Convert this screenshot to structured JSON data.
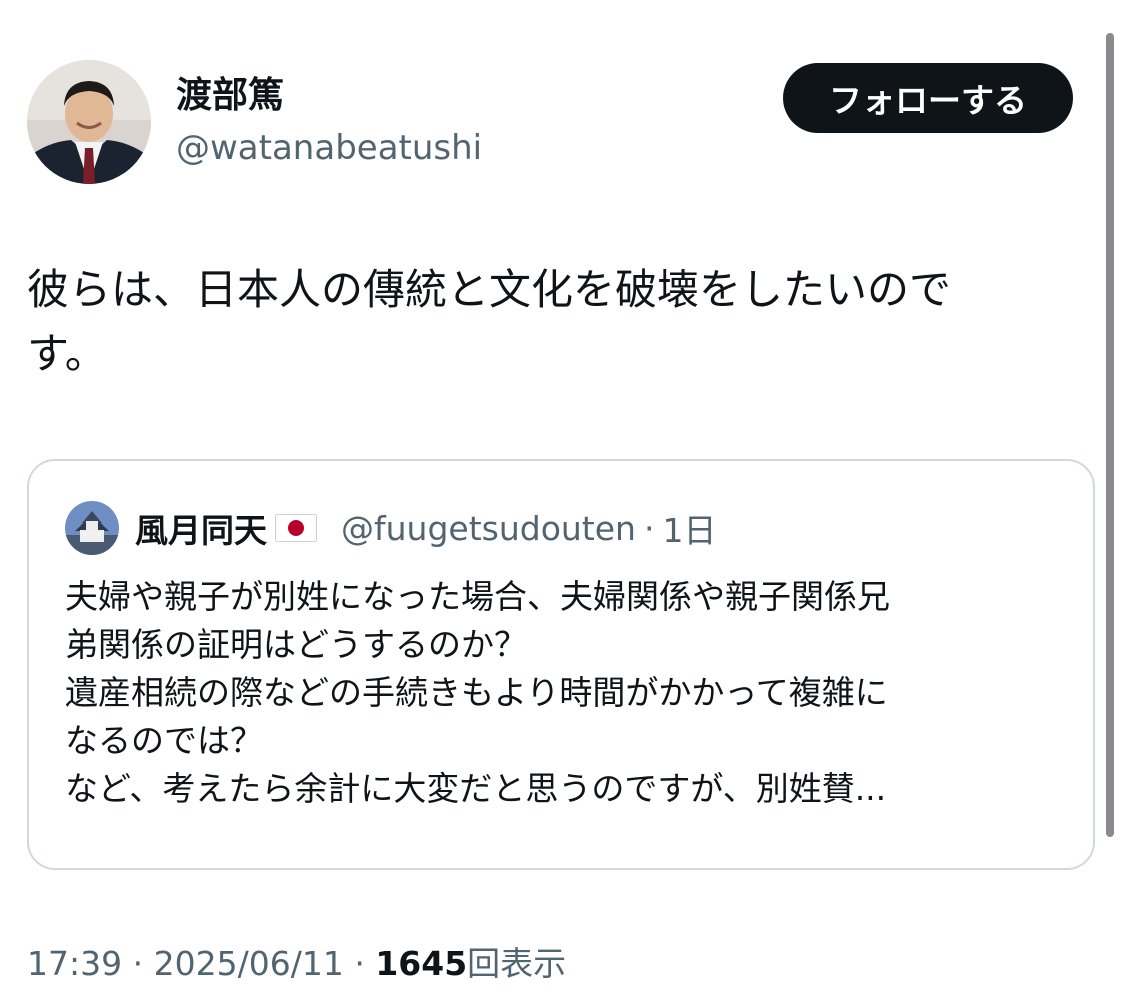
{
  "author": {
    "name": "渡部篤",
    "handle": "@watanabeatushi"
  },
  "follow_button": {
    "label": "フォローする"
  },
  "tweet": {
    "lines": [
      "彼らは、日本人の傳統と文化を破壊をしたいので",
      "す。"
    ]
  },
  "quoted_tweet": {
    "name": "風月同天",
    "flag_icon": "japan-flag-icon",
    "handle": "@fuugetsudouten",
    "separator": "·",
    "time": "1日",
    "lines": [
      "夫婦や親子が別姓になった場合、夫婦関係や親子関係兄",
      "弟関係の証明はどうするのか？",
      "遺産相続の際などの手続きもより時間がかかって複雑に",
      "なるのでは？",
      "など、考えたら余計に大変だと思うのですが、別姓賛..."
    ]
  },
  "meta": {
    "time": "17:39",
    "separator": "·",
    "date": "2025/06/11",
    "views_count": "1645",
    "views_label": "回表示"
  },
  "colors": {
    "text": "#0f1419",
    "secondary": "#536471",
    "border": "#cfd9de",
    "button_bg": "#0f1419",
    "flag_red": "#bc002d"
  }
}
